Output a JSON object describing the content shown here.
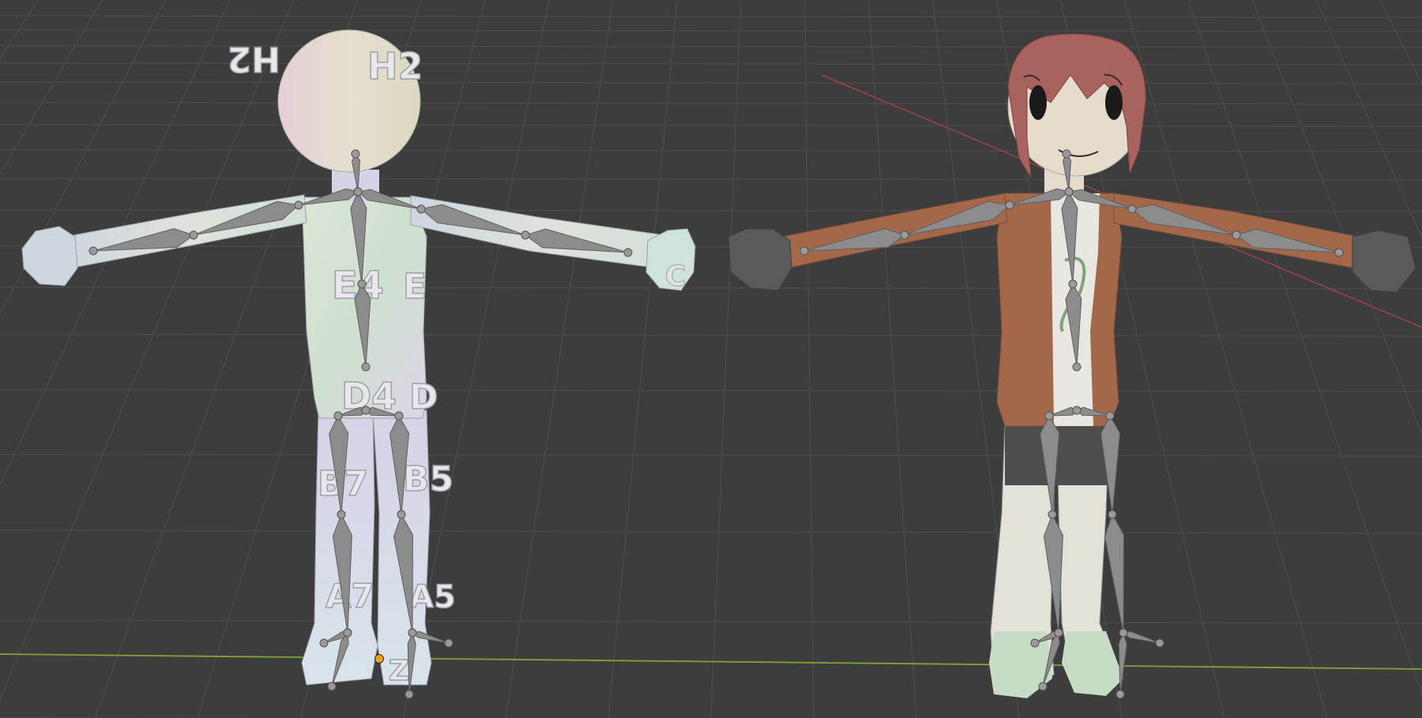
{
  "viewport": {
    "background_color": "#3d3d3d",
    "grid_color": "#4a4a4a",
    "x_axis_color": "#b84545",
    "y_axis_color": "#7fa33b",
    "origin_marker_color": "#f0a020"
  },
  "scene": {
    "left_model": {
      "texture_labels": {
        "head_left": "H2",
        "head_right": "H2",
        "chest_center": "E4",
        "chest_side": "E",
        "belly_center": "D4",
        "belly_side": "D",
        "thigh_left": "B7",
        "thigh_right": "B5",
        "shin_left": "A7",
        "shin_right": "A5",
        "foot_right": "Z",
        "shoulder_right": "C"
      }
    },
    "right_model": {
      "hair_color": "#a8635e",
      "jacket_color": "#a3674a",
      "skin_color": "#e6dccd",
      "glove_color": "#5a5a5a"
    },
    "bone_color": "#8c8c8c"
  }
}
